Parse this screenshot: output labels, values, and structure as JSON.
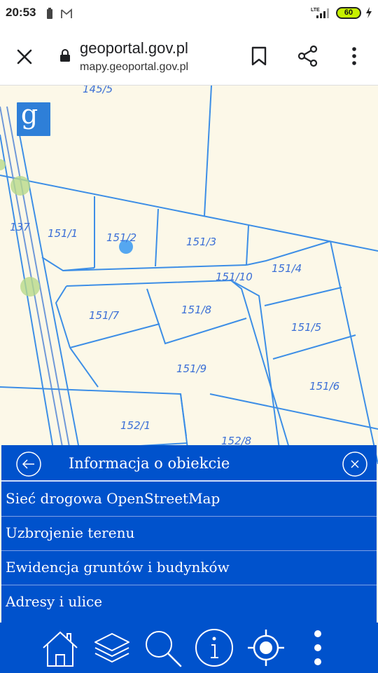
{
  "status_bar": {
    "time": "20:53",
    "network": "LTE",
    "battery": "60",
    "icons": [
      "battery-saver-icon",
      "gmail-icon",
      "signal-icon",
      "battery-icon",
      "charging-icon"
    ]
  },
  "browser": {
    "domain": "geoportal.gov.pl",
    "url": "mapy.geoportal.gov.pl",
    "icons": [
      "close-icon",
      "lock-icon",
      "bookmark-icon",
      "share-icon",
      "more-vertical-icon"
    ]
  },
  "map": {
    "logo_letter": "g",
    "parcels": [
      "145/5",
      "137",
      "151/1",
      "151/2",
      "151/3",
      "151/4",
      "151/10",
      "151/7",
      "151/8",
      "151/5",
      "151/9",
      "151/6",
      "152/1",
      "152/8"
    ],
    "colors": {
      "background": "#fcf8e8",
      "lines": "#3d8ee6",
      "labels": "#3b6fd6",
      "marker": "#55a7f0"
    }
  },
  "panel": {
    "title": "Informacja o obiekcie",
    "items": [
      {
        "label": "Sieć drogowa OpenStreetMap"
      },
      {
        "label": "Uzbrojenie terenu"
      },
      {
        "label": "Ewidencja gruntów i budynków"
      },
      {
        "label": "Adresy i ulice"
      }
    ],
    "icons": [
      "back-icon",
      "close-icon"
    ],
    "color": "#0052cc"
  },
  "toolbar": {
    "icons": [
      "home-icon",
      "layers-icon",
      "search-icon",
      "info-icon",
      "locate-icon",
      "more-vertical-icon"
    ]
  }
}
